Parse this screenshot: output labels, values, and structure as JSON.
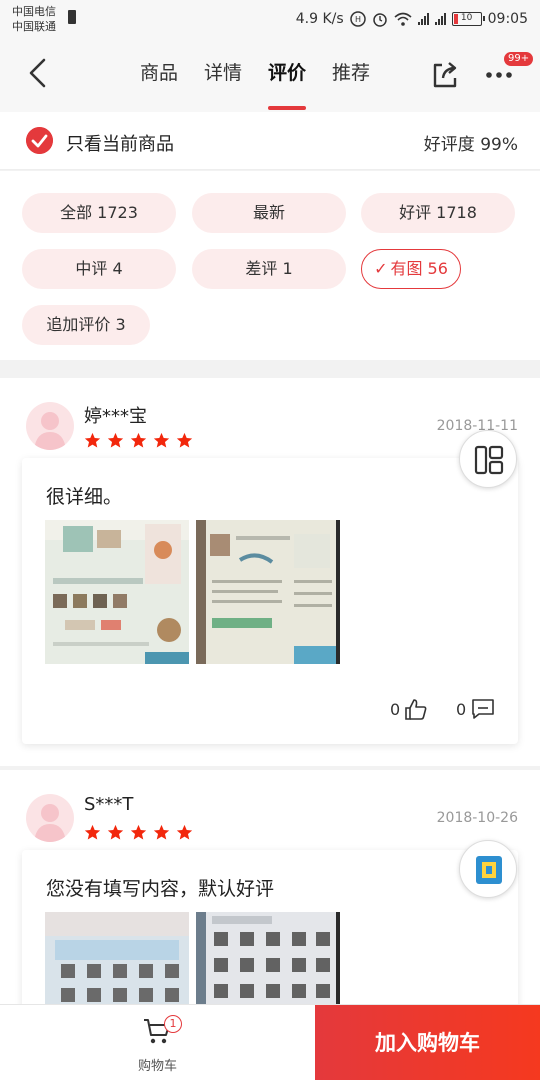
{
  "status_bar": {
    "carrier_1": "中国电信",
    "carrier_2": "中国联通",
    "speed": "4.9 K/s",
    "battery": "10",
    "time": "09:05"
  },
  "header": {
    "tabs": [
      {
        "label": "商品",
        "active": false
      },
      {
        "label": "详情",
        "active": false
      },
      {
        "label": "评价",
        "active": true
      },
      {
        "label": "推荐",
        "active": false
      }
    ],
    "more_badge": "99+"
  },
  "filter": {
    "only_current_label": "只看当前商品",
    "positive_rate": "好评度 99%"
  },
  "tags": [
    {
      "label": "全部 1723",
      "selected": false
    },
    {
      "label": "最新",
      "selected": false
    },
    {
      "label": "好评 1718",
      "selected": false
    },
    {
      "label": "中评 4",
      "selected": false
    },
    {
      "label": "差评 1",
      "selected": false
    },
    {
      "label": "有图 56",
      "selected": true
    },
    {
      "label": "追加评价 3",
      "selected": false
    }
  ],
  "reviews": [
    {
      "username": "婷***宝",
      "stars": 5,
      "date": "2018-11-11",
      "text": "很详细。",
      "likes": "0",
      "comments": "0"
    },
    {
      "username": "S***T",
      "stars": 5,
      "date": "2018-10-26",
      "text": "您没有填写内容，默认好评"
    }
  ],
  "bottom_bar": {
    "cart_label": "购物车",
    "cart_badge": "1",
    "add_to_cart_label": "加入购物车"
  },
  "colors": {
    "accent": "#e4393c",
    "star": "#f2270c",
    "tag_bg": "#fcecec"
  }
}
